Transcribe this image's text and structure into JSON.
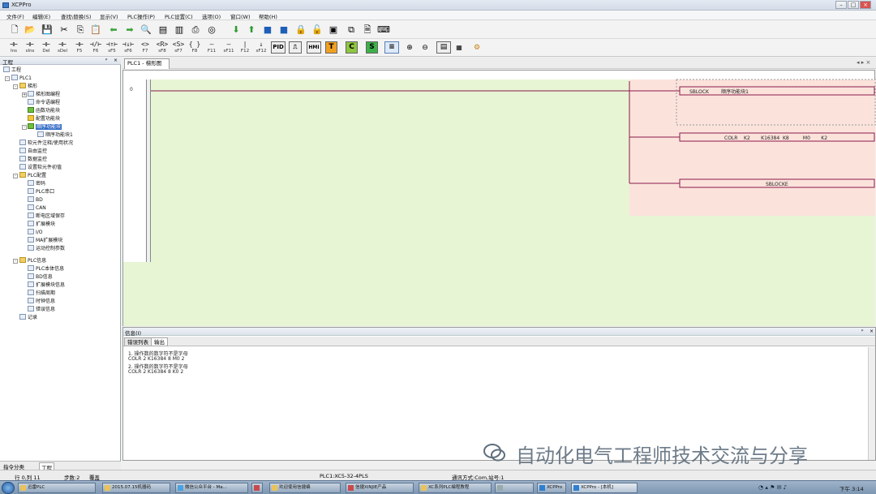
{
  "window": {
    "title": "XCPPro",
    "min": "–",
    "max": "□",
    "close": "×"
  },
  "menu": [
    "文件(F)",
    "编辑(E)",
    "查找\\替换(S)",
    "显示(V)",
    "PLC操作(P)",
    "PLC设置(C)",
    "选项(O)",
    "窗口(W)",
    "帮助(H)"
  ],
  "toolbar1_icons": [
    "new-icon",
    "open-icon",
    "save-icon",
    "cut-icon",
    "copy-icon",
    "paste-icon",
    "undo-icon",
    "redo-icon",
    "find-icon",
    "print-preview-icon",
    "page-setup-icon",
    "print-icon",
    "zoom-icon",
    "download-icon",
    "upload-icon",
    "run-icon",
    "stop-icon",
    "lock-icon",
    "unlock-icon",
    "monitor-icon",
    "compare-icon",
    "search-doc-icon",
    "keyboard-icon"
  ],
  "toolbar2": [
    {
      "g": "⊣⊢",
      "l": "Ins"
    },
    {
      "g": "⊣⊢",
      "l": "sIns"
    },
    {
      "g": "⊣⊢",
      "l": "Del"
    },
    {
      "g": "⊣⊢",
      "l": "sDel"
    },
    {
      "g": "⊣⊢",
      "l": "F5"
    },
    {
      "g": "⊣/⊢",
      "l": "F6"
    },
    {
      "g": "⊣↑⊢",
      "l": "sF5"
    },
    {
      "g": "⊣↓⊢",
      "l": "sF6"
    },
    {
      "g": "<>",
      "l": "F7"
    },
    {
      "g": "<R>",
      "l": "sF8"
    },
    {
      "g": "<S>",
      "l": "sF7"
    },
    {
      "g": "{ }",
      "l": "F8"
    },
    {
      "g": "—",
      "l": "F11"
    },
    {
      "g": "—",
      "l": "sF11"
    },
    {
      "g": "|",
      "l": "F12"
    },
    {
      "g": "↓",
      "l": "sF12"
    }
  ],
  "toolbar2_labels": {
    "pid": "PID",
    "hmi": "HMI",
    "t": "T",
    "c": "C",
    "s": "S"
  },
  "tree": {
    "header": "工程",
    "root": "工程",
    "items": [
      "PLC1",
      "梯形",
      "梯形图编程",
      "命令语编程",
      "函数功能块",
      "配置功能块",
      "顺序功能块",
      "顺序功能块1",
      "软元件注释/使用状况",
      "自由监控",
      "数据监控",
      "设置软元件初值",
      "PLC配置",
      "密码",
      "PLC串口",
      "BD",
      "CAN",
      "断电区域保存",
      "扩展模块",
      "I/O",
      "MA扩展模块",
      "运动控制参数",
      "PLC信息",
      "PLC本体信息",
      "BD信息",
      "扩展模块信息",
      "扫描周期",
      "时钟信息",
      "错误信息",
      "记录"
    ]
  },
  "left_bottom_tabs": [
    "指令分类",
    "工程"
  ],
  "editor": {
    "tab": "PLC1 - 梯形图",
    "rung": "0",
    "blocks": [
      "SBLOCK        顺序功能块1",
      "COLR    K2       K16384  K8         M0       K2",
      "SBLOCKE"
    ]
  },
  "info": {
    "header": "信息(I)",
    "tabs": [
      "错误列表",
      "输出"
    ],
    "messages": [
      "1. 操作数的数字符不是字母",
      "COLR 2 K16384 8 M0 2",
      "2. 操作数的数字符不是字母",
      "COLR 2 K16384 8 K0 2"
    ]
  },
  "status": {
    "rowcol": "行 0,列 11",
    "step": "步数:2",
    "mode": "覆盖",
    "plc": "PLC1:XC5-32-4PLS",
    "comm": "通讯方式:Com,站号:1"
  },
  "taskbar": [
    "迅雷PLC",
    "2015.07.15机器码",
    "微信公众平台 - Ma...",
    "",
    "欢迎使用信捷编",
    "信捷XINJIE产品",
    "XC系列PLC编程教程",
    "",
    "XCPPro",
    "XCPPro - [本机]"
  ],
  "clock": "下午 3:14",
  "watermark": "自动化电气工程师技术交流与分享",
  "colors": {
    "green": "#e7f5d4",
    "pink": "#fbe3dc",
    "rung": "#8b1a4a",
    "selection": "#3169c6"
  }
}
